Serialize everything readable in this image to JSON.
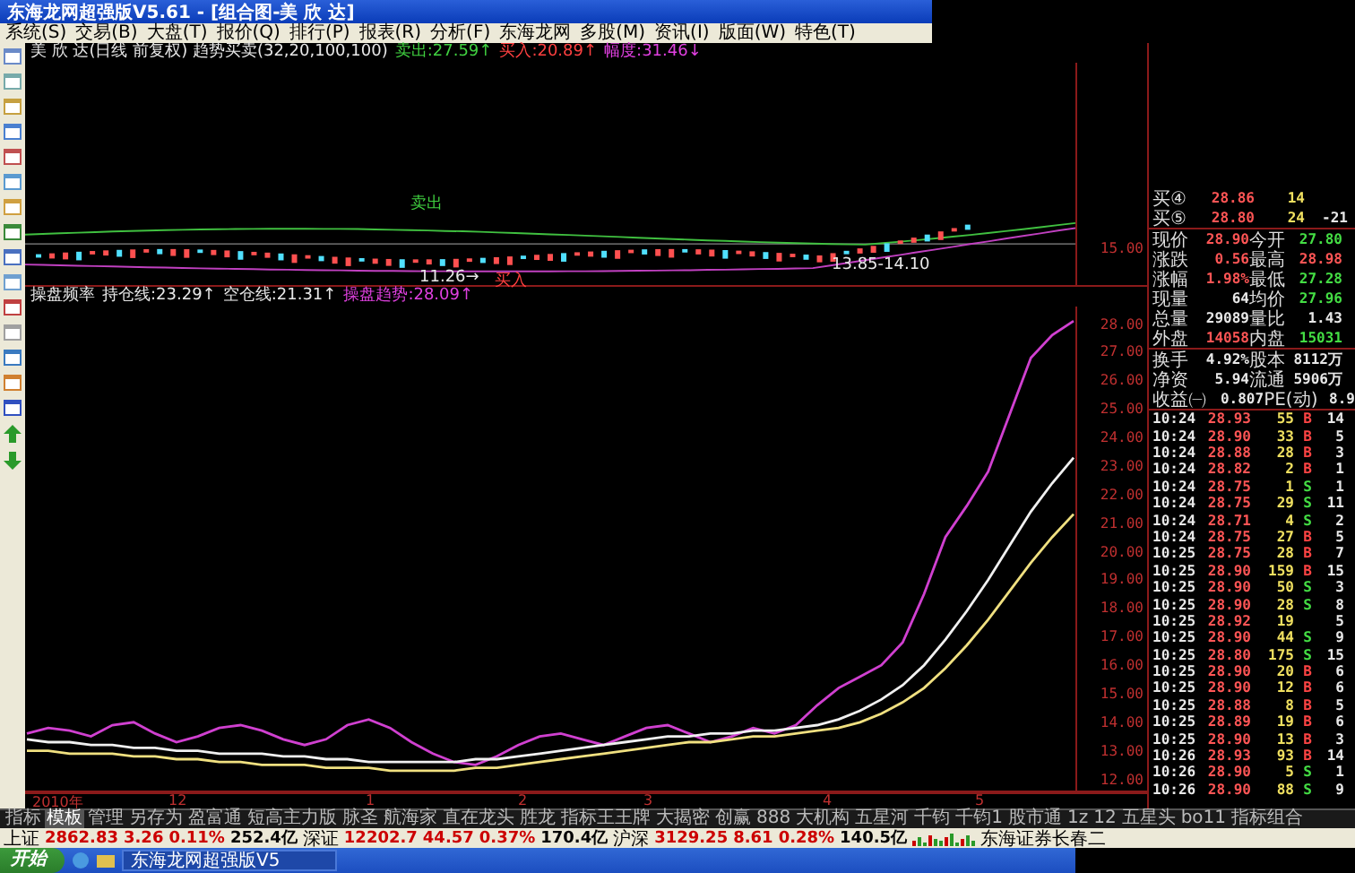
{
  "window": {
    "title": "东海龙网超强版V5.61 - [组合图-美 欣 达]"
  },
  "menu": [
    "系统(S)",
    "交易(B)",
    "大盘(T)",
    "报价(Q)",
    "排行(P)",
    "报表(R)",
    "分析(F)",
    "东海龙网",
    "多股(M)",
    "资讯(I)",
    "版面(W)",
    "特色(T)"
  ],
  "chart_header": {
    "title": "美 欣 达(日线 前复权) 趋势买卖(32,20,100,100)",
    "sell": "卖出:27.59↑",
    "buy": "买入:20.89↑",
    "range": "幅度:31.46↓"
  },
  "price_panel": {
    "axis_label": "15.00",
    "sell_mark": "卖出",
    "low_mark": "11.26→",
    "buy_mark": "买入",
    "zone_mark": "13.85-14.10"
  },
  "indicator_header": {
    "title": "操盘频率",
    "hold": "持仓线:23.29↑",
    "empty": "空仓线:21.31↑",
    "trend": "操盘趋势:28.09↑"
  },
  "chart_data": {
    "type": "line",
    "ylim": [
      11.6,
      28.6
    ],
    "yticks": [
      {
        "value": 28,
        "label": "28.00"
      },
      {
        "value": 27,
        "label": "27.00"
      },
      {
        "value": 26,
        "label": "26.00"
      },
      {
        "value": 25,
        "label": "25.00"
      },
      {
        "value": 24,
        "label": "24.00"
      },
      {
        "value": 23,
        "label": "23.00"
      },
      {
        "value": 22,
        "label": "22.00"
      },
      {
        "value": 21,
        "label": "21.00"
      },
      {
        "value": 20,
        "label": "20.00"
      },
      {
        "value": 19,
        "label": "19.00"
      },
      {
        "value": 18,
        "label": "18.00"
      },
      {
        "value": 17,
        "label": "17.00"
      },
      {
        "value": 16,
        "label": "16.00"
      },
      {
        "value": 15,
        "label": "15.00"
      },
      {
        "value": 14,
        "label": "14.00"
      },
      {
        "value": 13,
        "label": "13.00"
      },
      {
        "value": 12,
        "label": "12.00"
      }
    ],
    "series": [
      {
        "color": "#d040d0",
        "values": [
          13.6,
          13.8,
          13.7,
          13.5,
          13.9,
          14.0,
          13.6,
          13.3,
          13.5,
          13.8,
          13.9,
          13.7,
          13.4,
          13.2,
          13.4,
          13.9,
          14.1,
          13.8,
          13.3,
          12.9,
          12.6,
          12.5,
          12.8,
          13.2,
          13.5,
          13.6,
          13.4,
          13.2,
          13.5,
          13.8,
          13.9,
          13.6,
          13.3,
          13.5,
          13.8,
          13.6,
          13.9,
          14.6,
          15.2,
          15.6,
          16.0,
          16.8,
          18.5,
          20.5,
          21.6,
          22.8,
          24.8,
          26.8,
          27.6,
          28.09
        ]
      },
      {
        "color": "#f0f0f0",
        "values": [
          13.4,
          13.3,
          13.3,
          13.2,
          13.2,
          13.1,
          13.1,
          13.0,
          13.0,
          12.9,
          12.9,
          12.9,
          12.8,
          12.8,
          12.7,
          12.7,
          12.6,
          12.6,
          12.6,
          12.6,
          12.6,
          12.7,
          12.7,
          12.8,
          12.9,
          13.0,
          13.1,
          13.2,
          13.3,
          13.4,
          13.5,
          13.5,
          13.6,
          13.6,
          13.7,
          13.7,
          13.8,
          13.9,
          14.1,
          14.4,
          14.8,
          15.3,
          16.0,
          16.9,
          17.9,
          19.0,
          20.2,
          21.4,
          22.4,
          23.29
        ]
      },
      {
        "color": "#f0e080",
        "values": [
          13.0,
          13.0,
          12.9,
          12.9,
          12.9,
          12.8,
          12.8,
          12.7,
          12.7,
          12.6,
          12.6,
          12.5,
          12.5,
          12.5,
          12.4,
          12.4,
          12.4,
          12.3,
          12.3,
          12.3,
          12.3,
          12.4,
          12.4,
          12.5,
          12.6,
          12.7,
          12.8,
          12.9,
          13.0,
          13.1,
          13.2,
          13.3,
          13.3,
          13.4,
          13.5,
          13.5,
          13.6,
          13.7,
          13.8,
          14.0,
          14.3,
          14.7,
          15.2,
          15.9,
          16.7,
          17.6,
          18.6,
          19.6,
          20.5,
          21.31
        ]
      }
    ]
  },
  "date_axis": [
    "2010年",
    "12",
    "1",
    "2",
    "3",
    "4",
    "5"
  ],
  "bids": [
    {
      "label": "买④",
      "price": "28.86",
      "volume": "14"
    },
    {
      "label": "买⑤",
      "price": "28.80",
      "volume": "24",
      "change": "-21"
    }
  ],
  "quote": [
    [
      {
        "label": "现价",
        "value": "28.90",
        "color": "#ff5555"
      },
      {
        "label": "今开",
        "value": "27.80",
        "color": "#44dd44"
      }
    ],
    [
      {
        "label": "涨跌",
        "value": "0.56",
        "color": "#ff5555"
      },
      {
        "label": "最高",
        "value": "28.98",
        "color": "#ff5555"
      }
    ],
    [
      {
        "label": "涨幅",
        "value": "1.98%",
        "color": "#ff5555"
      },
      {
        "label": "最低",
        "value": "27.28",
        "color": "#44dd44"
      }
    ],
    [
      {
        "label": "现量",
        "value": "64",
        "color": "#e8e8e8"
      },
      {
        "label": "均价",
        "value": "27.96",
        "color": "#44dd44"
      }
    ],
    [
      {
        "label": "总量",
        "value": "29089",
        "color": "#e8e8e8"
      },
      {
        "label": "量比",
        "value": "1.43",
        "color": "#e8e8e8"
      }
    ],
    [
      {
        "label": "外盘",
        "value": "14058",
        "color": "#ff5555"
      },
      {
        "label": "内盘",
        "value": "15031",
        "color": "#44dd44"
      }
    ],
    [
      {
        "label": "换手",
        "value": "4.92%",
        "color": "#e8e8e8"
      },
      {
        "label": "股本",
        "value": "8112万",
        "color": "#e8e8e8"
      }
    ],
    [
      {
        "label": "净资",
        "value": "5.94",
        "color": "#e8e8e8"
      },
      {
        "label": "流通",
        "value": "5906万",
        "color": "#e8e8e8"
      }
    ],
    [
      {
        "label": "收益㈠",
        "value": "0.807",
        "color": "#e8e8e8"
      },
      {
        "label": "PE(动)",
        "value": "8.9",
        "color": "#e8e8e8"
      }
    ]
  ],
  "ticks": [
    {
      "time": "10:24",
      "price": "28.93",
      "volume": "55",
      "side": "B",
      "count": "14",
      "kind": "buy"
    },
    {
      "time": "10:24",
      "price": "28.90",
      "volume": "33",
      "side": "B",
      "count": "5",
      "kind": "buy"
    },
    {
      "time": "10:24",
      "price": "28.88",
      "volume": "28",
      "side": "B",
      "count": "3",
      "kind": "buy"
    },
    {
      "time": "10:24",
      "price": "28.82",
      "volume": "2",
      "side": "B",
      "count": "1",
      "kind": "buy"
    },
    {
      "time": "10:24",
      "price": "28.75",
      "volume": "1",
      "side": "S",
      "count": "1",
      "kind": "sell"
    },
    {
      "time": "10:24",
      "price": "28.75",
      "volume": "29",
      "side": "S",
      "count": "11",
      "kind": "sell"
    },
    {
      "time": "10:24",
      "price": "28.71",
      "volume": "4",
      "side": "S",
      "count": "2",
      "kind": "sell"
    },
    {
      "time": "10:24",
      "price": "28.75",
      "volume": "27",
      "side": "B",
      "count": "5",
      "kind": "buy"
    },
    {
      "time": "10:25",
      "price": "28.75",
      "volume": "28",
      "side": "B",
      "count": "7",
      "kind": "buy"
    },
    {
      "time": "10:25",
      "price": "28.90",
      "volume": "159",
      "side": "B",
      "count": "15",
      "kind": "buy"
    },
    {
      "time": "10:25",
      "price": "28.90",
      "volume": "50",
      "side": "S",
      "count": "3",
      "kind": "sell"
    },
    {
      "time": "10:25",
      "price": "28.90",
      "volume": "28",
      "side": "S",
      "count": "8",
      "kind": "sell"
    },
    {
      "time": "10:25",
      "price": "28.92",
      "volume": "19",
      "count": "5",
      "kind": "neutral"
    },
    {
      "time": "10:25",
      "price": "28.90",
      "volume": "44",
      "side": "S",
      "count": "9",
      "kind": "sell"
    },
    {
      "time": "10:25",
      "price": "28.80",
      "volume": "175",
      "side": "S",
      "count": "15",
      "kind": "sell"
    },
    {
      "time": "10:25",
      "price": "28.90",
      "volume": "20",
      "side": "B",
      "count": "6",
      "kind": "buy"
    },
    {
      "time": "10:25",
      "price": "28.90",
      "volume": "12",
      "side": "B",
      "count": "6",
      "kind": "buy"
    },
    {
      "time": "10:25",
      "price": "28.88",
      "volume": "8",
      "side": "B",
      "count": "5",
      "kind": "buy"
    },
    {
      "time": "10:25",
      "price": "28.89",
      "volume": "19",
      "side": "B",
      "count": "6",
      "kind": "buy"
    },
    {
      "time": "10:25",
      "price": "28.90",
      "volume": "13",
      "side": "B",
      "count": "3",
      "kind": "buy"
    },
    {
      "time": "10:26",
      "price": "28.93",
      "volume": "93",
      "side": "B",
      "count": "14",
      "kind": "buy"
    },
    {
      "time": "10:26",
      "price": "28.90",
      "volume": "5",
      "side": "S",
      "count": "1",
      "kind": "sell"
    },
    {
      "time": "10:26",
      "price": "28.90",
      "volume": "88",
      "side": "S",
      "count": "9",
      "kind": "sell"
    }
  ],
  "tabs": [
    {
      "label": "指标",
      "selected": false
    },
    {
      "label": "模板",
      "selected": true
    },
    {
      "label": "管理",
      "selected": false
    },
    {
      "label": "另存为",
      "selected": false
    },
    {
      "label": "盈富通",
      "selected": false
    },
    {
      "label": "短高主力版",
      "selected": false
    },
    {
      "label": "脉圣",
      "selected": false
    },
    {
      "label": "航海家",
      "selected": false
    },
    {
      "label": "直在龙头",
      "selected": false
    },
    {
      "label": "胜龙",
      "selected": false
    },
    {
      "label": "指标王王牌",
      "selected": false
    },
    {
      "label": "大揭密",
      "selected": false
    },
    {
      "label": "创赢",
      "selected": false
    },
    {
      "label": "888",
      "selected": false
    },
    {
      "label": "大机构",
      "selected": false
    },
    {
      "label": "五星河",
      "selected": false
    },
    {
      "label": "千钧",
      "selected": false
    },
    {
      "label": "千钧1",
      "selected": false
    },
    {
      "label": "股市通",
      "selected": false
    },
    {
      "label": "1z",
      "selected": false
    },
    {
      "label": "12",
      "selected": false
    },
    {
      "label": "五星头",
      "selected": false
    },
    {
      "label": "bo11",
      "selected": false
    },
    {
      "label": "指标组合",
      "selected": false
    }
  ],
  "indices": [
    {
      "name": "上证",
      "value": "2862.83",
      "change": "3.26",
      "percent": "0.11%",
      "amount": "252.4亿"
    },
    {
      "name": "深证",
      "value": "12202.7",
      "change": "44.57",
      "percent": "0.37%",
      "amount": "170.4亿"
    },
    {
      "name": "沪深",
      "value": "3129.25",
      "change": "8.61",
      "percent": "0.28%",
      "amount": "140.5亿"
    }
  ],
  "broker": "东海证券长春二",
  "taskbar": {
    "start": "开始",
    "task": "东海龙网超强版V5"
  }
}
